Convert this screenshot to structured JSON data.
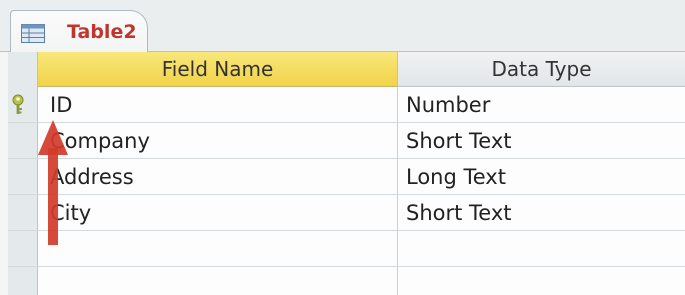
{
  "tab": {
    "label": "Table2",
    "icon": "table-icon"
  },
  "columns": {
    "field_name": "Field Name",
    "data_type": "Data Type"
  },
  "rows": [
    {
      "field_name": "ID",
      "data_type": "Number",
      "primary_key": true
    },
    {
      "field_name": "Company",
      "data_type": "Short Text",
      "primary_key": false
    },
    {
      "field_name": "Address",
      "data_type": "Long Text",
      "primary_key": false
    },
    {
      "field_name": "City",
      "data_type": "Short Text",
      "primary_key": false
    },
    {
      "field_name": "",
      "data_type": "",
      "primary_key": false
    },
    {
      "field_name": "",
      "data_type": "",
      "primary_key": false
    }
  ],
  "colors": {
    "tab_text": "#c0362c",
    "header_highlight": "#f1d34a",
    "arrow": "#d33b2a",
    "key": "#8a9a3a"
  },
  "annotation": {
    "arrow_icon": "red-up-arrow",
    "key_icon": "primary-key-icon"
  }
}
